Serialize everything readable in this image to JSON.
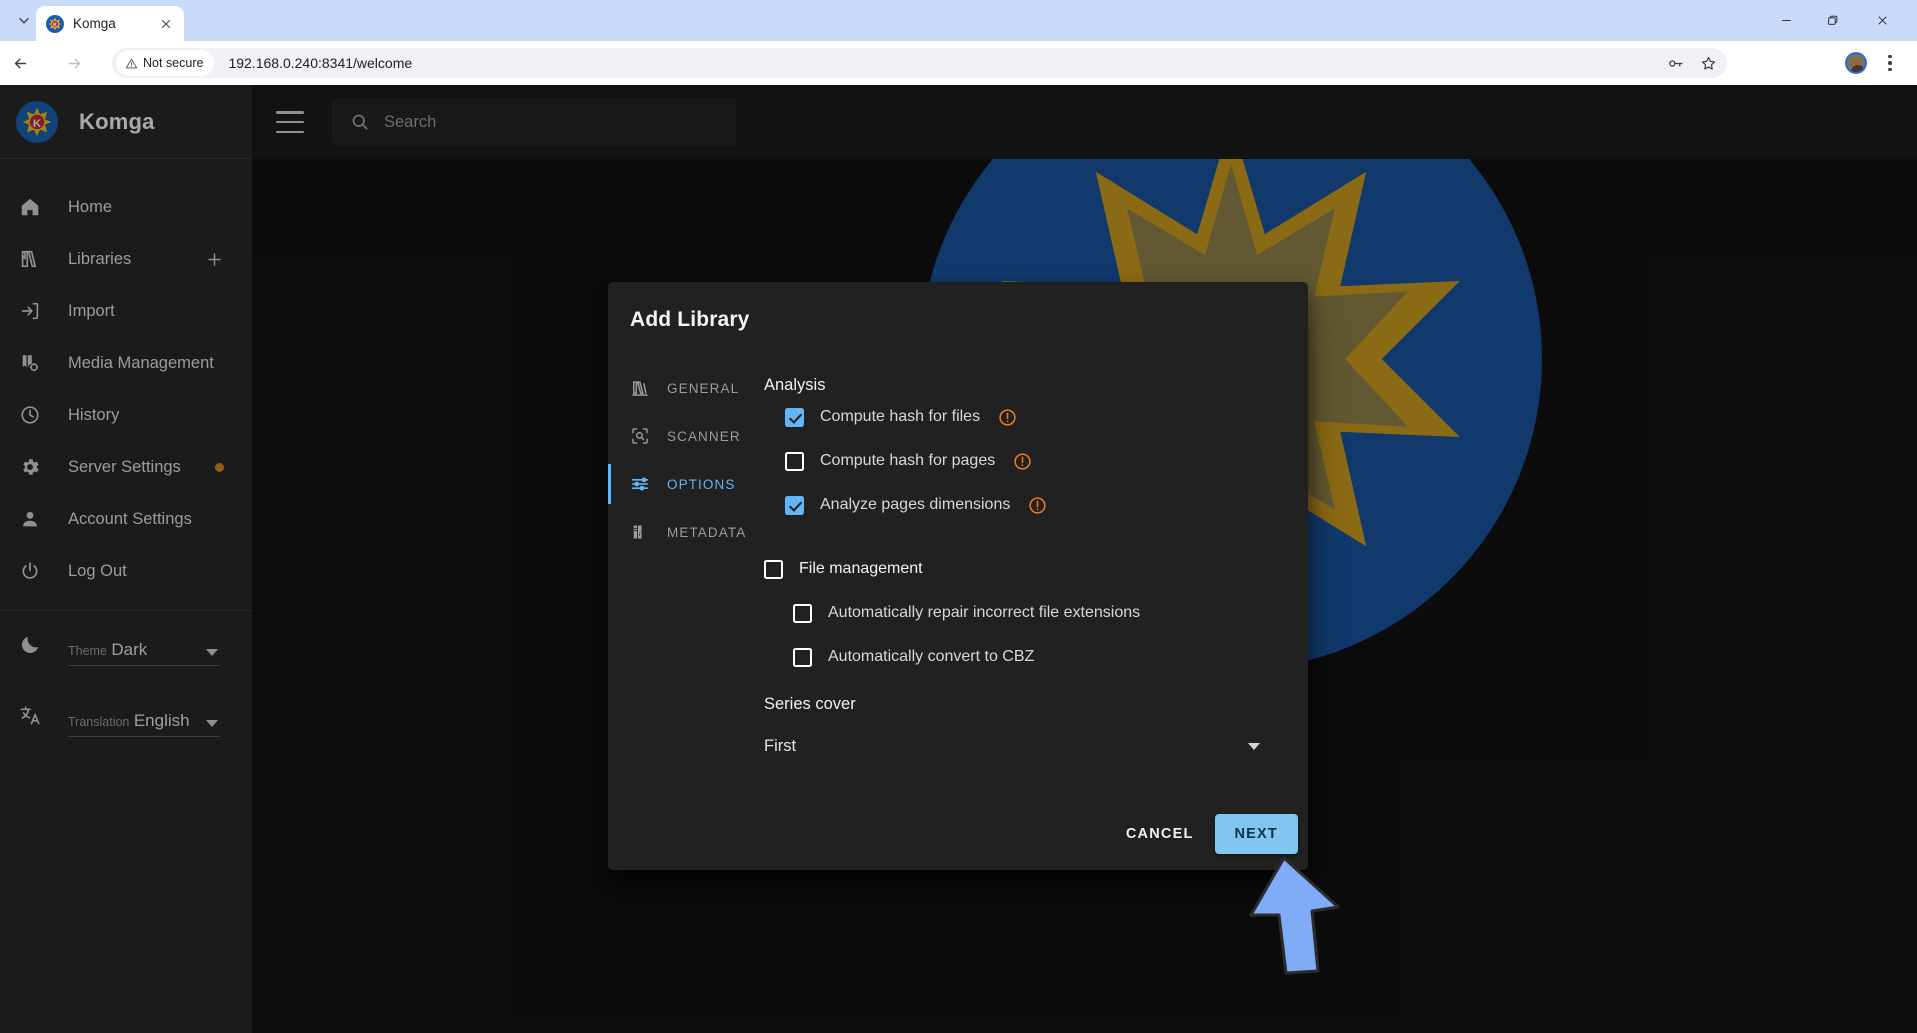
{
  "browser": {
    "tab": {
      "title": "Komga",
      "favicon_icon": "komga-favicon",
      "close_icon": "close-icon"
    },
    "tab_list_icon": "chevron-down-icon",
    "window_controls": {
      "minimize": "minimize-icon",
      "maximize": "maximize-icon",
      "close": "close-icon"
    },
    "nav": {
      "back_icon": "arrow-back-icon",
      "forward_icon": "arrow-forward-icon",
      "reload_icon": "reload-icon"
    },
    "omnibox": {
      "security_text": "Not secure",
      "security_icon": "warning-triangle-icon",
      "url": "192.168.0.240:8341/welcome",
      "password_icon": "key-icon",
      "bookmark_icon": "star-icon"
    },
    "profile_icon": "avatar-icon",
    "menu_icon": "kebab-menu-icon"
  },
  "sidebar": {
    "brand": {
      "title": "Komga",
      "logo_icon": "komga-logo-icon"
    },
    "items": [
      {
        "label": "Home",
        "icon": "home-icon",
        "trailing": null
      },
      {
        "label": "Libraries",
        "icon": "library-icon",
        "trailing": "plus-icon"
      },
      {
        "label": "Import",
        "icon": "import-icon",
        "trailing": null
      },
      {
        "label": "Media Management",
        "icon": "media-management-icon",
        "trailing": null
      },
      {
        "label": "History",
        "icon": "clock-icon",
        "trailing": null
      },
      {
        "label": "Server Settings",
        "icon": "gear-icon",
        "trailing": "dot-badge"
      },
      {
        "label": "Account Settings",
        "icon": "person-icon",
        "trailing": null
      },
      {
        "label": "Log Out",
        "icon": "power-icon",
        "trailing": null
      }
    ],
    "theme_select": {
      "caption": "Theme",
      "value": "Dark",
      "icon": "moon-icon"
    },
    "translation_select": {
      "caption": "Translation",
      "value": "English",
      "icon": "translate-icon"
    }
  },
  "appbar": {
    "menu_icon": "hamburger-icon",
    "search": {
      "placeholder": "Search",
      "icon": "search-icon"
    }
  },
  "content": {
    "watermark_icon": "komga-starburst-logo"
  },
  "dialog": {
    "title": "Add Library",
    "tabs": [
      {
        "label": "GENERAL",
        "icon": "library-books-icon",
        "active": false
      },
      {
        "label": "SCANNER",
        "icon": "scan-search-icon",
        "active": false
      },
      {
        "label": "OPTIONS",
        "icon": "sliders-icon",
        "active": true
      },
      {
        "label": "METADATA",
        "icon": "metadata-icon",
        "active": false
      }
    ],
    "panel": {
      "analysis_heading": "Analysis",
      "analysis_options": [
        {
          "label": "Compute hash for files",
          "checked": true,
          "warning": true
        },
        {
          "label": "Compute hash for pages",
          "checked": false,
          "warning": true
        },
        {
          "label": "Analyze pages dimensions",
          "checked": true,
          "warning": true
        }
      ],
      "file_management": {
        "label": "File management",
        "checked": false
      },
      "file_management_options": [
        {
          "label": "Automatically repair incorrect file extensions",
          "checked": false
        },
        {
          "label": "Automatically convert to CBZ",
          "checked": false
        }
      ],
      "series_cover_label": "Series cover",
      "series_cover_value": "First",
      "series_cover_arrow_icon": "chevron-down-icon"
    },
    "actions": {
      "cancel_label": "CANCEL",
      "next_label": "NEXT"
    }
  },
  "cursor": {
    "icon": "mouse-arrow-cursor",
    "color": "#7fabf7"
  },
  "colors": {
    "accent_blue": "#64b5f6",
    "button_blue": "#80c6f0",
    "warning_orange": "#ef7b16",
    "badge_orange": "#d98324",
    "logo_blue": "#19529b",
    "logo_gold": "#c8991f",
    "sidebar_bg": "#272727",
    "dialog_bg": "#212121",
    "content_bg": "#121212"
  }
}
